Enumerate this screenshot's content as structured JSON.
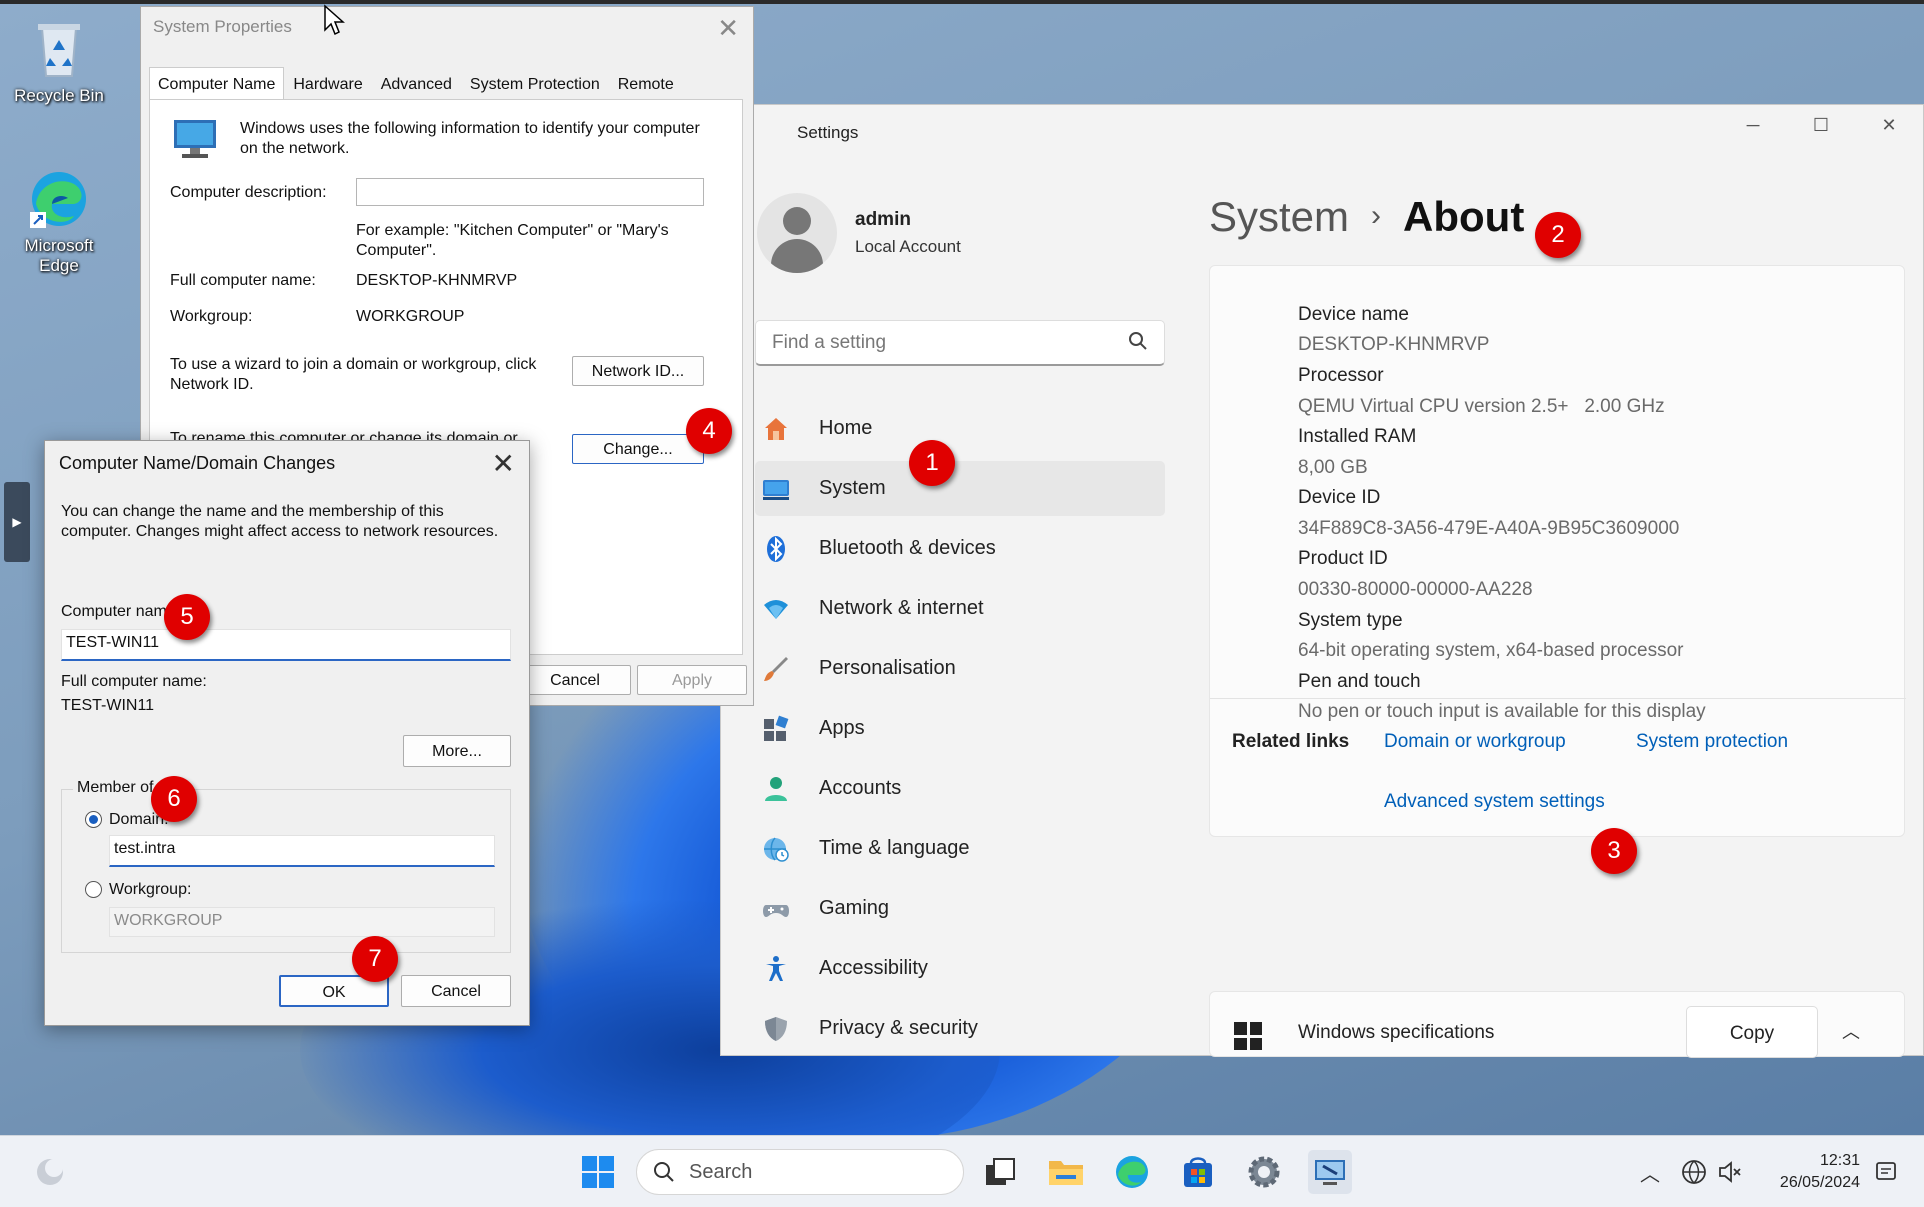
{
  "desktop": {
    "icons": [
      {
        "label_line1": "Recycle Bin",
        "label_line2": "",
        "icon": "recycle-bin-icon"
      },
      {
        "label_line1": "Microsoft",
        "label_line2": "Edge",
        "icon": "edge-icon"
      }
    ]
  },
  "system_properties": {
    "title": "System Properties",
    "tabs": [
      "Computer Name",
      "Hardware",
      "Advanced",
      "System Protection",
      "Remote"
    ],
    "intro_line1": "Windows uses the following information to identify your computer",
    "intro_line2": "on the network.",
    "description_label": "Computer description:",
    "description_value": "",
    "example_line1": "For example: \"Kitchen Computer\" or \"Mary's",
    "example_line2": "Computer\".",
    "full_name_label": "Full computer name:",
    "full_name_value": "DESKTOP-KHNMRVP",
    "workgroup_label": "Workgroup:",
    "workgroup_value": "WORKGROUP",
    "wizard_line1": "To use a wizard to join a domain or workgroup, click",
    "wizard_line2": "Network ID.",
    "network_id_button": "Network ID...",
    "rename_text": "To rename this computer or change its domain or",
    "change_button": "Change...",
    "cancel_button": "Cancel",
    "apply_button": "Apply"
  },
  "name_domain_dialog": {
    "title": "Computer Name/Domain Changes",
    "intro_line1": "You can change the name and the membership of this",
    "intro_line2": "computer. Changes might affect access to network resources.",
    "computer_name_label": "Computer nam",
    "computer_name_value": "TEST-WIN11",
    "full_name_label": "Full computer name:",
    "full_name_value": "TEST-WIN11",
    "more_button": "More...",
    "member_of_label": "Member of",
    "domain_label": "Domain:",
    "domain_value": "test.intra",
    "workgroup_label": "Workgroup:",
    "workgroup_value": "WORKGROUP",
    "ok_button": "OK",
    "cancel_button": "Cancel"
  },
  "settings": {
    "window_title": "Settings",
    "user_name": "admin",
    "account_type": "Local Account",
    "search_placeholder": "Find a setting",
    "nav": [
      {
        "label": "Home",
        "icon": "home-icon",
        "color": "#e8743b"
      },
      {
        "label": "System",
        "icon": "system-icon",
        "color": "#2f7fd1"
      },
      {
        "label": "Bluetooth & devices",
        "icon": "bluetooth-icon",
        "color": "#1e6fd9"
      },
      {
        "label": "Network & internet",
        "icon": "wifi-icon",
        "color": "#1e90d9"
      },
      {
        "label": "Personalisation",
        "icon": "brush-icon",
        "color": "#e07a3a"
      },
      {
        "label": "Apps",
        "icon": "apps-icon",
        "color": "#555f6d"
      },
      {
        "label": "Accounts",
        "icon": "accounts-icon",
        "color": "#22a27a"
      },
      {
        "label": "Time & language",
        "icon": "globe-clock-icon",
        "color": "#2d8fd0"
      },
      {
        "label": "Gaming",
        "icon": "gamepad-icon",
        "color": "#7a8a9a"
      },
      {
        "label": "Accessibility",
        "icon": "accessibility-icon",
        "color": "#1d6ec9"
      },
      {
        "label": "Privacy & security",
        "icon": "shield-icon",
        "color": "#7c8794"
      }
    ],
    "breadcrumb_parent": "System",
    "breadcrumb_current": "About",
    "specs": [
      {
        "key": "Device name",
        "value": "DESKTOP-KHNMRVP"
      },
      {
        "key": "Processor",
        "value": "QEMU Virtual CPU version 2.5+   2.00 GHz"
      },
      {
        "key": "Installed RAM",
        "value": "8,00 GB"
      },
      {
        "key": "Device ID",
        "value": "34F889C8-3A56-479E-A40A-9B95C3609000"
      },
      {
        "key": "Product ID",
        "value": "00330-80000-00000-AA228"
      },
      {
        "key": "System type",
        "value": "64-bit operating system, x64-based processor"
      },
      {
        "key": "Pen and touch",
        "value": "No pen or touch input is available for this display"
      }
    ],
    "related_links_label": "Related links",
    "related_links": [
      "Domain or workgroup",
      "System protection",
      "Advanced system settings"
    ],
    "windows_specs_label": "Windows specifications",
    "copy_button": "Copy"
  },
  "markers": [
    "1",
    "2",
    "3",
    "4",
    "5",
    "6",
    "7"
  ],
  "taskbar": {
    "search_placeholder": "Search",
    "time": "12:31",
    "date": "26/05/2024"
  }
}
